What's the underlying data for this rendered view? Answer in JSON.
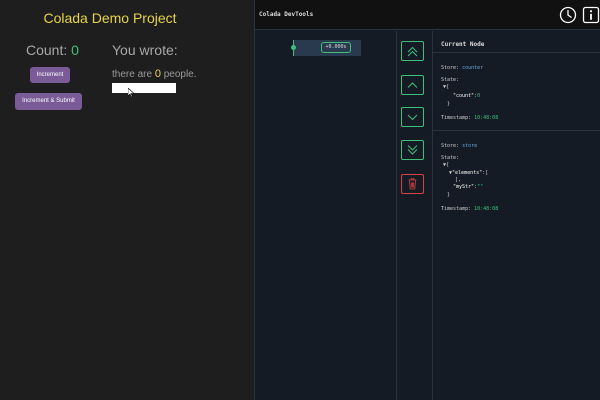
{
  "app": {
    "title": "Colada Demo Project",
    "count_label": "Count: ",
    "count_value": "0",
    "increment_label": "Increment",
    "increment_submit_label": "Increment & Submit",
    "wrote_label": "You wrote:",
    "sentence_pre": "there are ",
    "sentence_num": "0",
    "sentence_post": " people.",
    "input_value": ""
  },
  "devtools": {
    "title": "Colada DevTools",
    "header_icons": [
      "clock-icon",
      "info-icon"
    ],
    "timeline": {
      "chip_label": "+0.000s"
    },
    "controls": [
      "double-chevron-up-icon",
      "chevron-up-icon",
      "chevron-down-icon",
      "double-chevron-down-icon",
      "trash-icon"
    ],
    "node_panel": {
      "title": "Current Node",
      "stores": [
        {
          "store_label": "Store: ",
          "store_name": "counter",
          "state_label": "State:",
          "open": "▼{",
          "key": "\"count\"",
          "sep": ":",
          "value": "0",
          "close": "}",
          "timestamp_label": "Timestamp: ",
          "timestamp": "10:48:08"
        },
        {
          "store_label": "Store: ",
          "store_name": "store",
          "state_label": "State:",
          "open": "▼{",
          "key1_prefix": "▼",
          "key1": "\"elements\"",
          "key1_sep": ":[",
          "key1_close": "],",
          "key2": "\"myStr\"",
          "key2_sep": ":",
          "key2_value": "\"\"",
          "close": "}",
          "timestamp_label": "Timestamp: ",
          "timestamp": "10:48:08"
        }
      ]
    }
  },
  "colors": {
    "accent_green": "#3ec07a",
    "title_yellow": "#e6d44a",
    "button_purple": "#7a5a97",
    "delete_red": "#d94141",
    "key_blue": "#6fa8dc"
  }
}
